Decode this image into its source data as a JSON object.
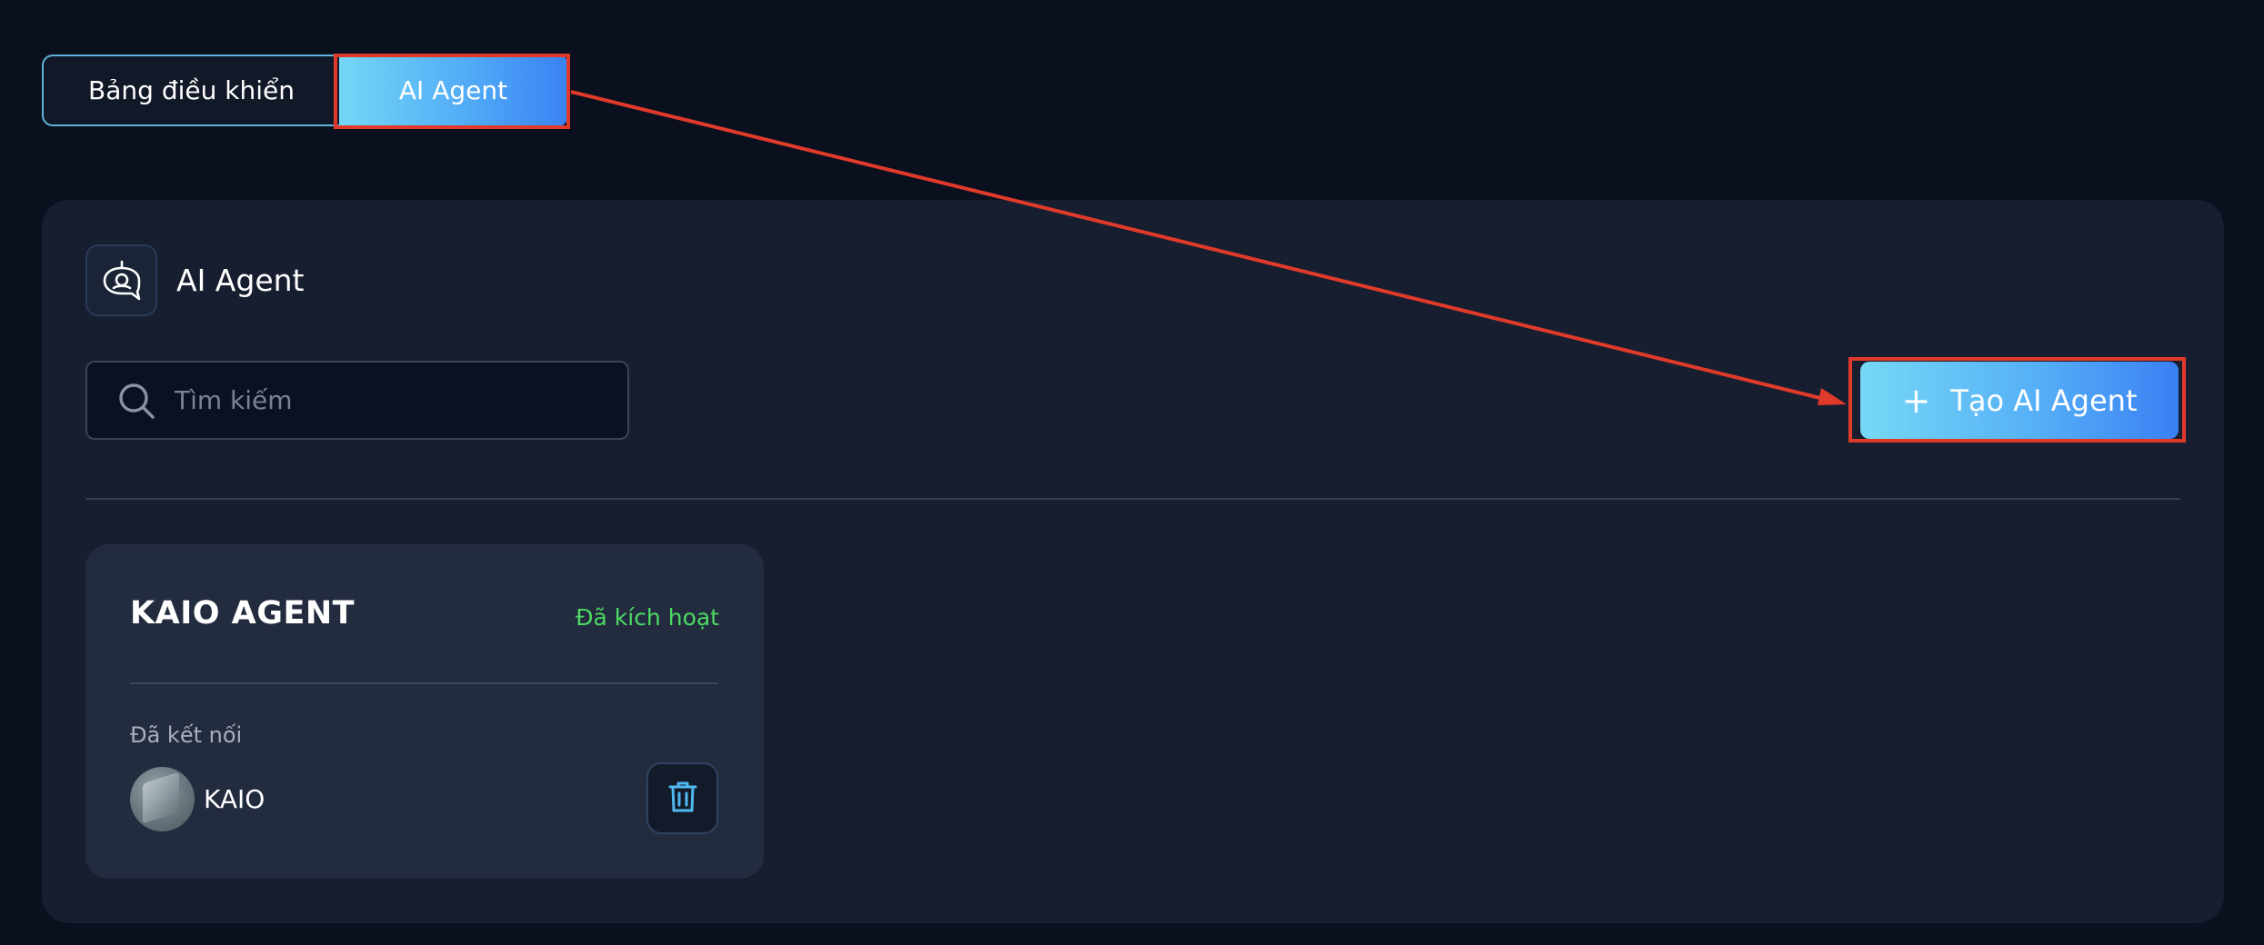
{
  "tabs": {
    "dashboard_label": "Bảng điều khiển",
    "ai_agent_label": "AI Agent"
  },
  "panel": {
    "title": "AI Agent",
    "header_icon": "robot-chat-icon"
  },
  "search": {
    "placeholder": "Tìm kiếm",
    "value": "",
    "icon": "search-icon"
  },
  "create_button": {
    "label": "Tạo AI Agent",
    "icon": "plus-icon",
    "icon_glyph": "+"
  },
  "agents": [
    {
      "name": "KAIO AGENT",
      "status": "Đã kích hoạt",
      "connected_label": "Đã kết nối",
      "connected_name": "KAIO",
      "delete_icon": "trash-icon"
    }
  ],
  "colors": {
    "background": "#0a101d",
    "panel": "#171e2f",
    "card": "#232c3e",
    "accent_gradient_start": "#74d7f6",
    "accent_gradient_end": "#3a82f4",
    "status_active": "#4cd964",
    "annotation": "#e03a2a"
  }
}
